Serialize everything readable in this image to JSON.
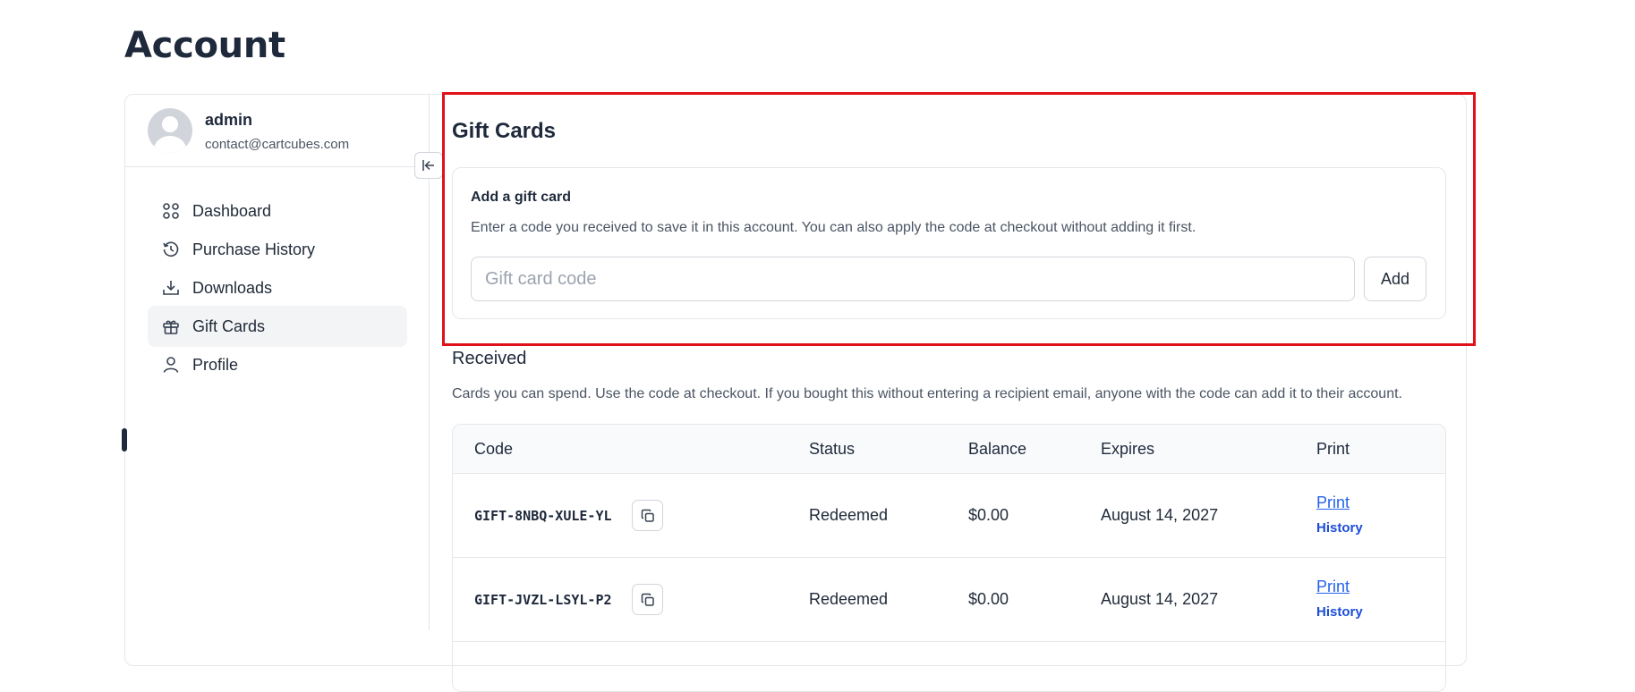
{
  "page": {
    "title": "Account"
  },
  "user": {
    "name": "admin",
    "email": "contact@cartcubes.com"
  },
  "nav": {
    "items": [
      {
        "label": "Dashboard",
        "icon": "grid-icon"
      },
      {
        "label": "Purchase History",
        "icon": "history-icon"
      },
      {
        "label": "Downloads",
        "icon": "download-icon"
      },
      {
        "label": "Gift Cards",
        "icon": "gift-icon",
        "active": true
      },
      {
        "label": "Profile",
        "icon": "user-icon"
      }
    ]
  },
  "gift_cards": {
    "title": "Gift Cards",
    "add": {
      "title": "Add a gift card",
      "description": "Enter a code you received to save it in this account. You can also apply the code at checkout without adding it first.",
      "placeholder": "Gift card code",
      "value": "",
      "button_label": "Add"
    },
    "received": {
      "title": "Received",
      "description": "Cards you can spend. Use the code at checkout. If you bought this without entering a recipient email, anyone with the code can add it to their account.",
      "columns": [
        "Code",
        "Status",
        "Balance",
        "Expires",
        "Print"
      ],
      "rows": [
        {
          "code": "GIFT-8NBQ-XULE-YL",
          "status": "Redeemed",
          "balance": "$0.00",
          "expires": "August 14, 2027",
          "print": "Print",
          "history": "History"
        },
        {
          "code": "GIFT-JVZL-LSYL-P2",
          "status": "Redeemed",
          "balance": "$0.00",
          "expires": "August 14, 2027",
          "print": "Print",
          "history": "History"
        }
      ]
    }
  },
  "colors": {
    "highlight": "#e0111b",
    "link": "#2563eb",
    "text": "#1e293b"
  }
}
